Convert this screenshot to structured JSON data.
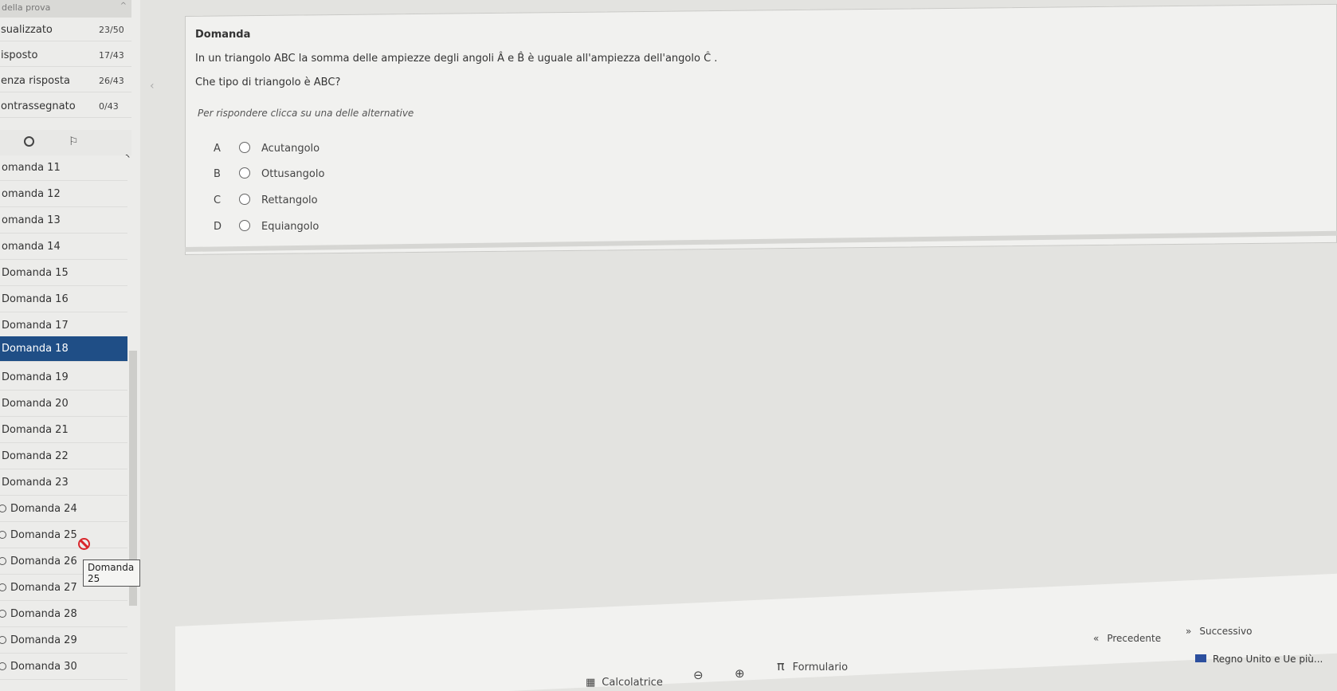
{
  "sidebar": {
    "header": "della prova",
    "stats": [
      {
        "label": "sualizzato",
        "count": "23/50"
      },
      {
        "label": "isposto",
        "count": "17/43"
      },
      {
        "label": "enza risposta",
        "count": "26/43"
      },
      {
        "label": "ontrassegnato",
        "count": "0/43"
      }
    ],
    "questions": [
      "omanda 11",
      "omanda 12",
      "omanda 13",
      "omanda 14",
      "Domanda 15",
      "Domanda 16",
      "Domanda 17",
      "Domanda 18",
      "Domanda 19",
      "Domanda 20",
      "Domanda 21",
      "Domanda 22",
      "Domanda 23",
      "Domanda 24",
      "Domanda 25",
      "Domanda 26",
      "Domanda 27",
      "Domanda 28",
      "Domanda 29",
      "Domanda 30"
    ],
    "active_question": "Domanda 18",
    "tooltip": "Domanda 25"
  },
  "question": {
    "title": "Domanda",
    "text": "In un triangolo ABC la somma delle ampiezze degli angoli Â e B̂ è uguale all'ampiezza dell'angolo Ĉ .",
    "subtext": "Che tipo di triangolo è ABC?",
    "instruction": "Per rispondere clicca su una delle alternative",
    "options": [
      {
        "letter": "A",
        "label": "Acutangolo"
      },
      {
        "letter": "B",
        "label": "Ottusangolo"
      },
      {
        "letter": "C",
        "label": "Rettangolo"
      },
      {
        "letter": "D",
        "label": "Equiangolo"
      }
    ]
  },
  "toolbar": {
    "calculator": "Calcolatrice",
    "zoom_out": "⊖",
    "zoom_in": "⊕",
    "formulary_icon": "π",
    "formulary": "Formulario",
    "prev": "Precedente",
    "next": "Successivo",
    "prev_icon": "«",
    "next_icon": "»",
    "taskbar_news": "Regno Unito e Ue più..."
  },
  "colors": {
    "active_item": "#1f4e86",
    "blocked_icon": "#d9262b"
  }
}
